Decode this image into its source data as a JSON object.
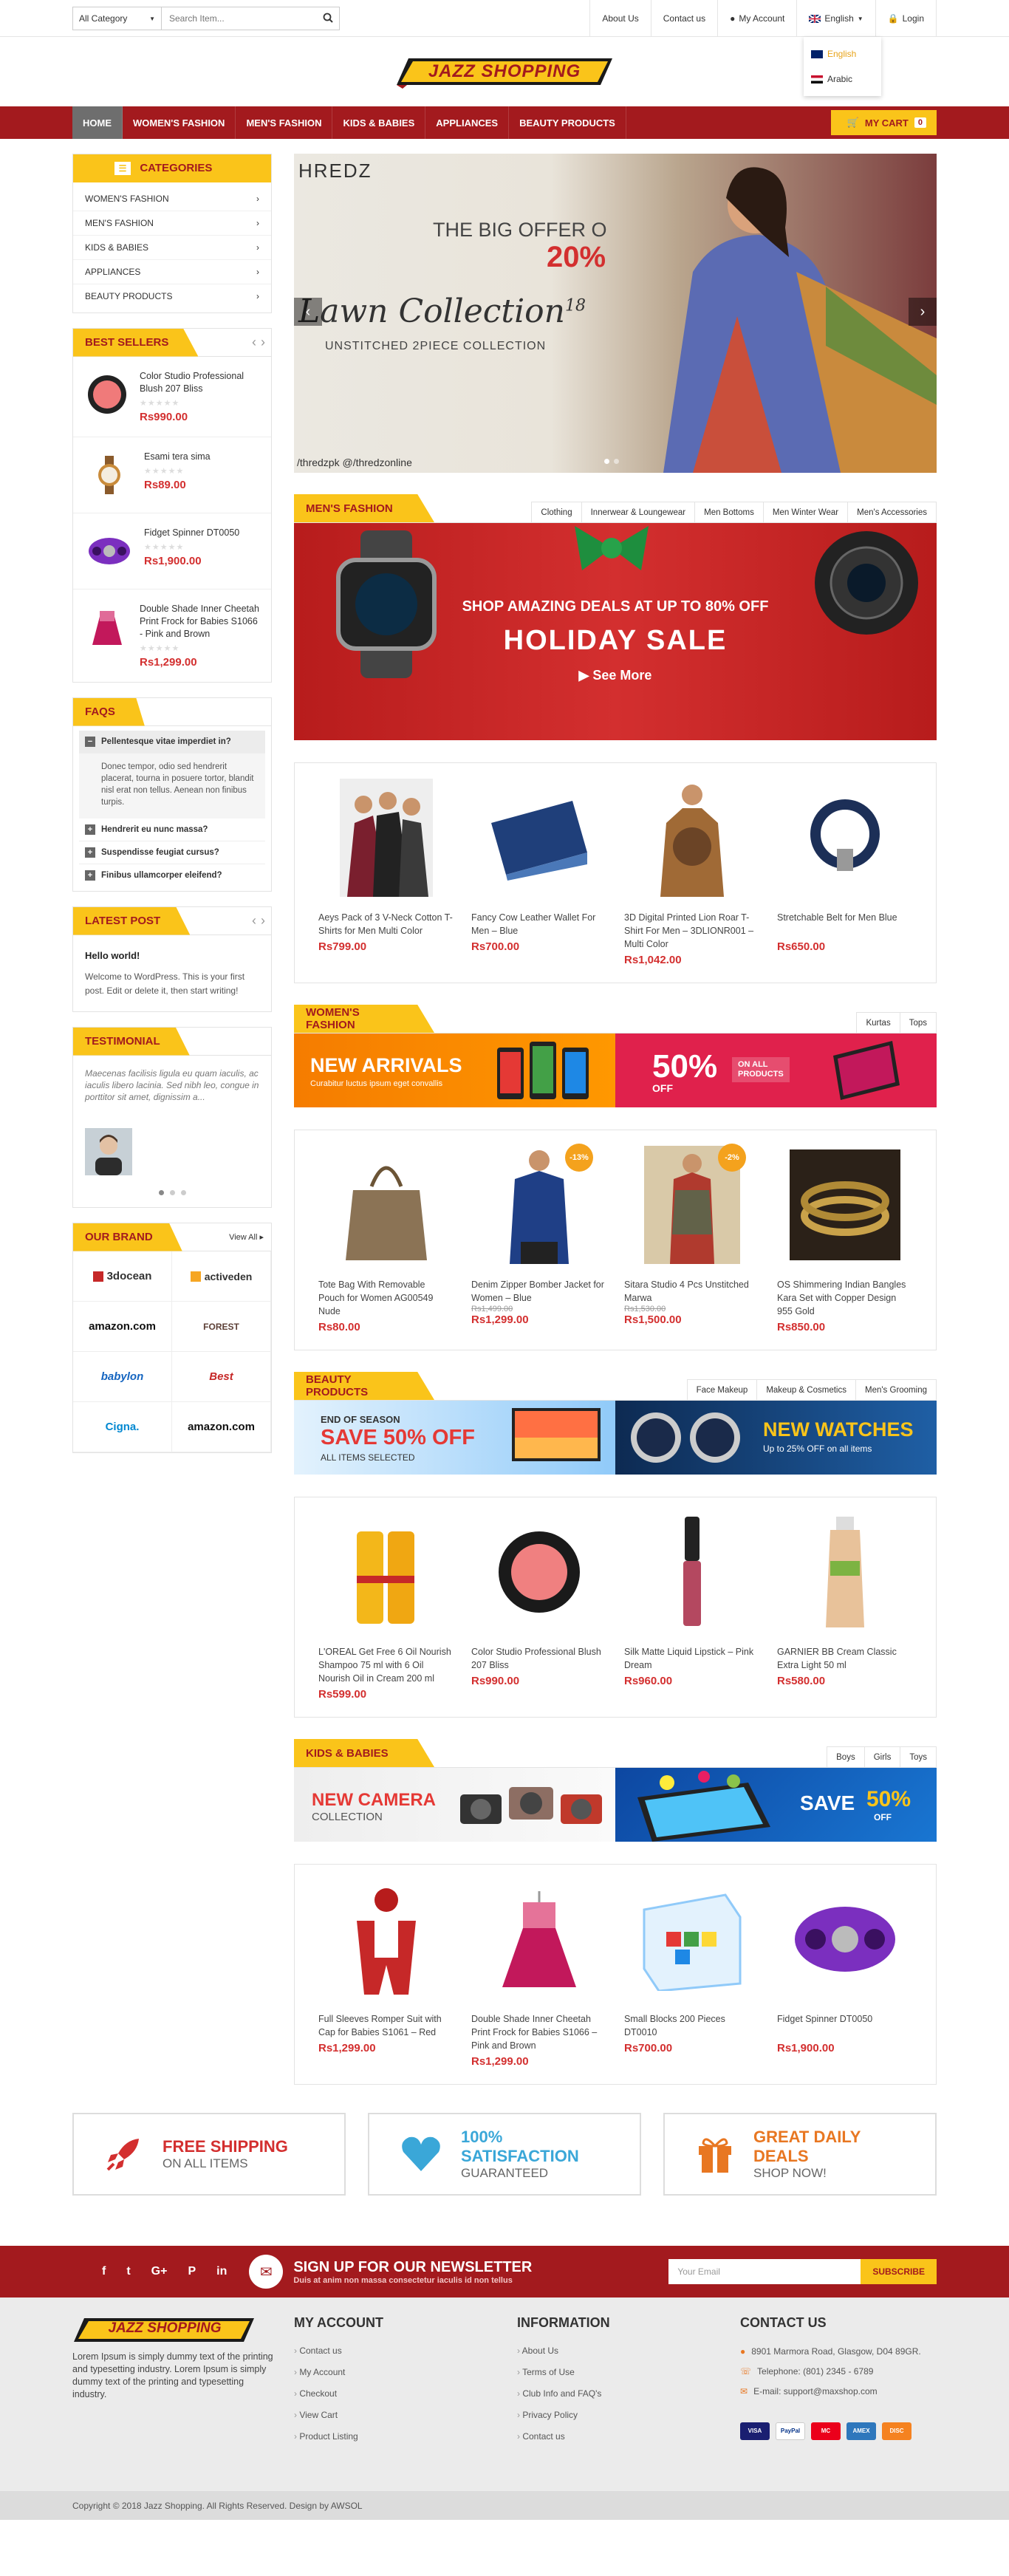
{
  "topbar": {
    "category_select": "All Category",
    "search_placeholder": "Search Item...",
    "links": [
      "About Us",
      "Contact us",
      "My Account",
      "English",
      "Login"
    ],
    "lang_options": [
      "English",
      "Arabic"
    ]
  },
  "brand": {
    "logo_text": "JAZZ SHOPPING"
  },
  "nav": {
    "items": [
      "HOME",
      "WOMEN'S FASHION",
      "MEN'S FASHION",
      "KIDS & BABIES",
      "APPLIANCES",
      "BEAUTY PRODUCTS"
    ],
    "cart_label": "MY CART",
    "cart_count": "0"
  },
  "categories": {
    "title": "CATEGORIES",
    "items": [
      "WOMEN'S FASHION",
      "MEN'S FASHION",
      "KIDS & BABIES",
      "APPLIANCES",
      "BEAUTY PRODUCTS"
    ]
  },
  "best_sellers": {
    "title": "BEST SELLERS",
    "items": [
      {
        "name": "Color Studio Professional Blush 207 Bliss",
        "price": "Rs990.00"
      },
      {
        "name": "Esami tera sima",
        "price": "Rs89.00"
      },
      {
        "name": "Fidget Spinner DT0050",
        "price": "Rs1,900.00"
      },
      {
        "name": "Double Shade Inner Cheetah Print Frock for Babies S1066 - Pink and Brown",
        "price": "Rs1,299.00"
      }
    ]
  },
  "faqs": {
    "title": "FAQS",
    "items": [
      {
        "q": "Pellentesque vitae imperdiet in?",
        "a": "Donec tempor, odio sed hendrerit placerat, tourna in posuere tortor, blandit nisl erat non tellus. Aenean non finibus turpis."
      },
      {
        "q": "Hendrerit eu nunc massa?"
      },
      {
        "q": "Suspendisse feugiat cursus?"
      },
      {
        "q": "Finibus ullamcorper eleifend?"
      }
    ]
  },
  "latest_post": {
    "title": "LATEST POST",
    "post_title": "Hello world!",
    "post_text": "Welcome to WordPress. This is your first post. Edit or delete it, then start writing!"
  },
  "testimonial": {
    "title": "TESTIMONIAL",
    "text": "Maecenas facilisis ligula eu quam iaculis, ac iaculis libero lacinia. Sed nibh leo, congue in porttitor sit amet, dignissim a..."
  },
  "our_brand": {
    "title": "OUR BRAND",
    "view_all": "View All",
    "items": [
      "3docean",
      "activeden",
      "amazon.com",
      "FOREST",
      "babylon",
      "Best",
      "Cigna.",
      "amazon.com"
    ]
  },
  "slider": {
    "brand": "HREDZ",
    "offer": "THE BIG OFFER O",
    "percent": "20%",
    "collection": "Lawn Collection",
    "sup": "18",
    "subtitle": "UNSTITCHED 2PIECE COLLECTION",
    "social": "/thredzpk  @/thredzonline"
  },
  "mens": {
    "title": "MEN'S FASHION",
    "tabs": [
      "Clothing",
      "Innerwear & Loungewear",
      "Men Bottoms",
      "Men Winter Wear",
      "Men's Accessories"
    ],
    "banner_line1": "SHOP AMAZING DEALS AT UP TO 80% OFF",
    "banner_line2": "HOLIDAY SALE",
    "banner_line3": "See More",
    "products": [
      {
        "name": "Aeys Pack of 3 V-Neck Cotton T-Shirts for Men Multi Color",
        "price": "Rs799.00"
      },
      {
        "name": "Fancy Cow Leather Wallet For Men – Blue",
        "price": "Rs700.00"
      },
      {
        "name": "3D Digital Printed Lion Roar T-Shirt For Men – 3DLIONR001 – Multi Color",
        "price": "Rs1,042.00"
      },
      {
        "name": "Stretchable Belt for Men Blue",
        "price": "Rs650.00"
      }
    ]
  },
  "womens": {
    "title": "WOMEN'S FASHION",
    "tabs": [
      "Kurtas",
      "Tops"
    ],
    "banner_left_title": "NEW ARRIVALS",
    "banner_left_sub": "Curabitur luctus ipsum eget convallis",
    "banner_right_pct": "50%",
    "banner_right_off": "OFF",
    "banner_right_tag1": "ON ALL",
    "banner_right_tag2": "PRODUCTS",
    "products": [
      {
        "name": "Tote Bag With Removable Pouch for Women AG00549 Nude",
        "price": "Rs80.00",
        "old": ""
      },
      {
        "name": "Denim Zipper Bomber Jacket for Women – Blue",
        "price": "Rs1,299.00",
        "old": "Rs1,499.00",
        "badge": "-13%"
      },
      {
        "name": "Sitara Studio 4 Pcs Unstitched Marwa",
        "price": "Rs1,500.00",
        "old": "Rs1,530.00",
        "badge": "-2%"
      },
      {
        "name": "OS Shimmering Indian Bangles Kara Set with Copper Design 955 Gold",
        "price": "Rs850.00",
        "old": ""
      }
    ]
  },
  "beauty": {
    "title": "BEAUTY PRODUCTS",
    "tabs": [
      "Face Makeup",
      "Makeup & Cosmetics",
      "Men's Grooming"
    ],
    "banner_left_top": "END OF SEASON",
    "banner_left_big": "SAVE 50% OFF",
    "banner_left_sub": "ALL ITEMS SELECTED",
    "banner_right_big": "NEW WATCHES",
    "banner_right_sub": "Up to 25% OFF on all items",
    "products": [
      {
        "name": "L'OREAL Get Free 6 Oil Nourish Shampoo 75 ml with 6 Oil Nourish Oil in Cream 200 ml",
        "price": "Rs599.00"
      },
      {
        "name": "Color Studio Professional Blush 207 Bliss",
        "price": "Rs990.00"
      },
      {
        "name": "Silk Matte Liquid Lipstick – Pink Dream",
        "price": "Rs960.00"
      },
      {
        "name": "GARNIER BB Cream Classic Extra Light 50 ml",
        "price": "Rs580.00"
      }
    ]
  },
  "kids": {
    "title": "KIDS & BABIES",
    "tabs": [
      "Boys",
      "Girls",
      "Toys"
    ],
    "banner_left_big": "NEW CAMERA",
    "banner_left_sub": "COLLECTION",
    "banner_right_big": "SAVE",
    "banner_right_pct": "50%",
    "banner_right_off": "OFF",
    "products": [
      {
        "name": "Full Sleeves Romper Suit with Cap for Babies S1061 – Red",
        "price": "Rs1,299.00"
      },
      {
        "name": "Double Shade Inner Cheetah Print Frock for Babies S1066 – Pink and Brown",
        "price": "Rs1,299.00"
      },
      {
        "name": "Small Blocks 200 Pieces DT0010",
        "price": "Rs700.00"
      },
      {
        "name": "Fidget Spinner DT0050",
        "price": "Rs1,900.00"
      }
    ]
  },
  "features": [
    {
      "t1": "FREE SHIPPING",
      "t2": "ON ALL ITEMS",
      "color": "#d32f2f"
    },
    {
      "t1": "100% SATISFACTION",
      "t2": "GUARANTEED",
      "color": "#3aa7d8"
    },
    {
      "t1": "GREAT DAILY DEALS",
      "t2": "SHOP NOW!",
      "color": "#e87722"
    }
  ],
  "newsletter": {
    "title": "SIGN UP FOR OUR NEWSLETTER",
    "sub": "Duis at anim non massa consectetur iaculis id non tellus",
    "placeholder": "Your Email",
    "button": "SUBSCRIBE",
    "social": [
      "f",
      "t",
      "G+",
      "P",
      "in"
    ]
  },
  "footer": {
    "about": "Lorem Ipsum is simply dummy text of the printing and typesetting industry. Lorem Ipsum is simply dummy text of the printing and typesetting industry.",
    "my_account": {
      "title": "MY ACCOUNT",
      "items": [
        "Contact us",
        "My Account",
        "Checkout",
        "View Cart",
        "Product Listing"
      ]
    },
    "information": {
      "title": "INFORMATION",
      "items": [
        "About Us",
        "Terms of Use",
        "Club Info and FAQ's",
        "Privacy Policy",
        "Contact us"
      ]
    },
    "contact": {
      "title": "CONTACT US",
      "address": "8901 Marmora Road, Glasgow, D04 89GR.",
      "phone": "Telephone: (801) 2345 - 6789",
      "email": "E-mail: support@maxshop.com"
    },
    "cards": [
      "VISA",
      "PayPal",
      "MC",
      "AMEX",
      "DISC"
    ],
    "copyright": "Copyright © 2018 Jazz Shopping. All Rights Reserved. Design by AWSOL"
  },
  "colors": {
    "brand_red": "#a31a1e",
    "accent_yellow": "#fac41a",
    "price_red": "#d32f2f"
  }
}
